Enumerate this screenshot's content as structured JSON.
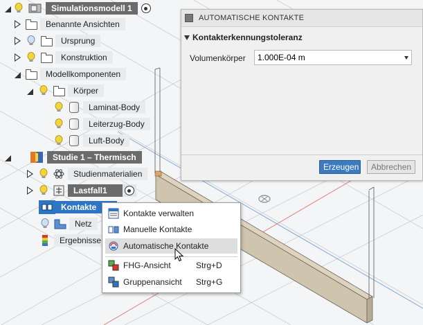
{
  "tree": {
    "root": "Simulationsmodell 1",
    "named_views": "Benannte Ansichten",
    "origin": "Ursprung",
    "construction": "Konstruktion",
    "components": "Modellkomponenten",
    "bodies": "Körper",
    "body1": "Laminat-Body",
    "body2": "Leiterzug-Body",
    "body3": "Luft-Body",
    "study": "Studie 1 – Thermisch",
    "materials": "Studienmaterialien",
    "loadcase": "Lastfall1",
    "contacts": "Kontakte",
    "mesh": "Netz",
    "results": "Ergebnisse"
  },
  "dialog": {
    "title": "AUTOMATISCHE KONTAKTE",
    "group": "Kontakterkennungstoleranz",
    "field_label": "Volumenkörper",
    "field_value": "1.000E-04 m",
    "ok": "Erzeugen",
    "cancel": "Abbrechen"
  },
  "menu": {
    "manage": "Kontakte verwalten",
    "manual": "Manuelle Kontakte",
    "automatic": "Automatische Kontakte",
    "dof_view": "FHG-Ansicht",
    "dof_key": "Strg+D",
    "group_view": "Gruppenansicht",
    "group_key": "Strg+G"
  },
  "colors": {
    "selection": "#2e75c4",
    "primary_button": "#3d7bc0",
    "grid_red": "#e27b7b",
    "grid_blue": "#7da9d6"
  }
}
